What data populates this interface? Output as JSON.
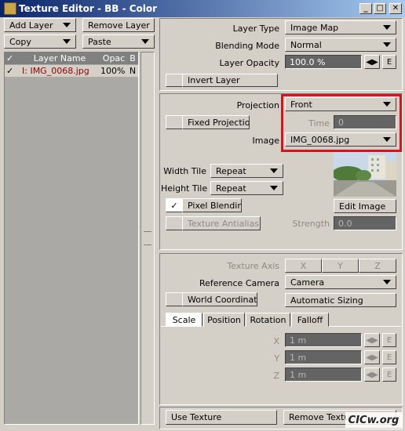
{
  "window": {
    "title": "Texture Editor - BB - Color",
    "minimize": "_",
    "maximize": "□",
    "close": "✕"
  },
  "left": {
    "add_layer": "Add Layer",
    "remove_layer": "Remove Layer",
    "copy": "Copy",
    "paste": "Paste",
    "columns": {
      "check": "✓",
      "name": "Layer Name",
      "opac": "Opac",
      "b": "B"
    },
    "rows": [
      {
        "check": "✓",
        "name": "I: IMG_0068.jpg",
        "opac": "100%",
        "b": "N"
      }
    ]
  },
  "layer": {
    "type_label": "Layer Type",
    "type_value": "Image Map",
    "blend_label": "Blending Mode",
    "blend_value": "Normal",
    "opacity_label": "Layer Opacity",
    "opacity_value": "100.0 %",
    "e_label": "E",
    "invert": "Invert Layer"
  },
  "image": {
    "projection_label": "Projection",
    "projection_value": "Front",
    "fixed_projection": "Fixed Projection",
    "time_label": "Time",
    "time_value": "0",
    "image_label": "Image",
    "image_value": "IMG_0068.jpg",
    "width_tile_label": "Width Tile",
    "width_tile_value": "Repeat",
    "height_tile_label": "Height Tile",
    "height_tile_value": "Repeat",
    "pixel_blending": "Pixel Blending",
    "edit_image": "Edit Image",
    "texture_antialiasing": "Texture Antialiasing",
    "strength_label": "Strength",
    "strength_value": "0.0"
  },
  "axis": {
    "texture_axis_label": "Texture Axis",
    "x": "X",
    "y": "Y",
    "z": "Z",
    "ref_camera_label": "Reference Camera",
    "ref_camera_value": "Camera",
    "world_coordinates": "World Coordinates",
    "automatic_sizing": "Automatic Sizing",
    "tabs": [
      "Scale",
      "Position",
      "Rotation",
      "Falloff"
    ],
    "rows": [
      {
        "label": "X",
        "value": "1 m",
        "e": "E"
      },
      {
        "label": "Y",
        "value": "1 m",
        "e": "E"
      },
      {
        "label": "Z",
        "value": "1 m",
        "e": "E"
      }
    ]
  },
  "bottom": {
    "use_texture": "Use Texture",
    "remove_texture": "Remove Texture"
  },
  "watermark": "CICw.org",
  "colors": {
    "accent_red": "#e0101a",
    "title_bar": "#0a246a",
    "layer_name_red": "#8b0000"
  }
}
